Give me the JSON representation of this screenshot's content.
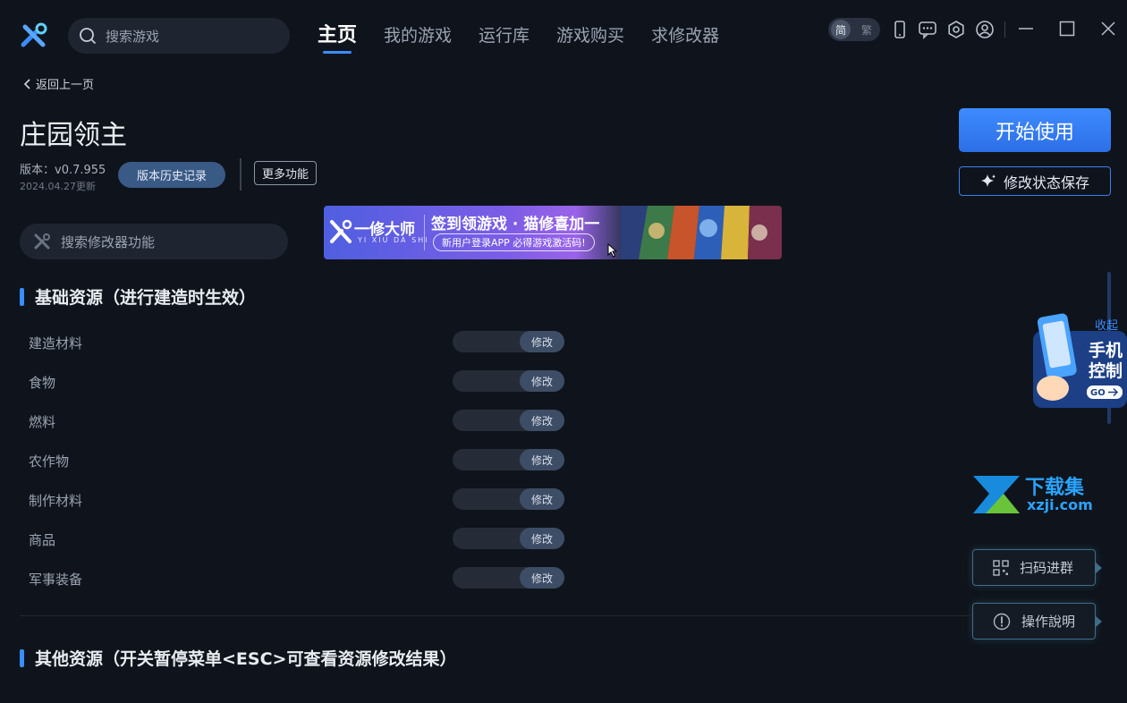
{
  "header": {
    "search_placeholder": "搜索游戏",
    "nav": [
      "主页",
      "我的游戏",
      "运行库",
      "游戏购买",
      "求修改器"
    ],
    "active_nav": "主页",
    "lang_selected": "简",
    "lang_other": "繁"
  },
  "page": {
    "back_label": "返回上一页",
    "title": "庄园领主",
    "version": "版本：v0.7.955",
    "update_date": "2024.04.27更新",
    "history_button": "版本历史记录",
    "more_button": "更多功能",
    "func_search_placeholder": "搜索修改器功能"
  },
  "banner": {
    "brand": "一修大师",
    "brand_sub": "YI XIU DA SHI",
    "headline": "签到领游戏 · 猫修喜加一",
    "pill": "新用户登录APP  必得游戏激活码!"
  },
  "sections": [
    {
      "title": "基础资源（进行建造时生效）",
      "rows": [
        {
          "label": "建造材料",
          "action": "修改"
        },
        {
          "label": "食物",
          "action": "修改"
        },
        {
          "label": "燃料",
          "action": "修改"
        },
        {
          "label": "农作物",
          "action": "修改"
        },
        {
          "label": "制作材料",
          "action": "修改"
        },
        {
          "label": "商品",
          "action": "修改"
        },
        {
          "label": "军事装备",
          "action": "修改"
        }
      ]
    },
    {
      "title": "其他资源（开关暂停菜单<ESC>可查看资源修改结果）",
      "rows": []
    }
  ],
  "side": {
    "start_button": "开始使用",
    "save_button": "修改状态保存",
    "collapse": "收起",
    "phone_promo_line1": "手机",
    "phone_promo_line2": "控制",
    "phone_promo_go": "GO",
    "watermark_cn": "下载集",
    "watermark_url": "xzji.com",
    "qr_button": "扫码进群",
    "help_button": "操作說明"
  },
  "colors": {
    "accent": "#3b8cff",
    "background": "#0f141c"
  }
}
